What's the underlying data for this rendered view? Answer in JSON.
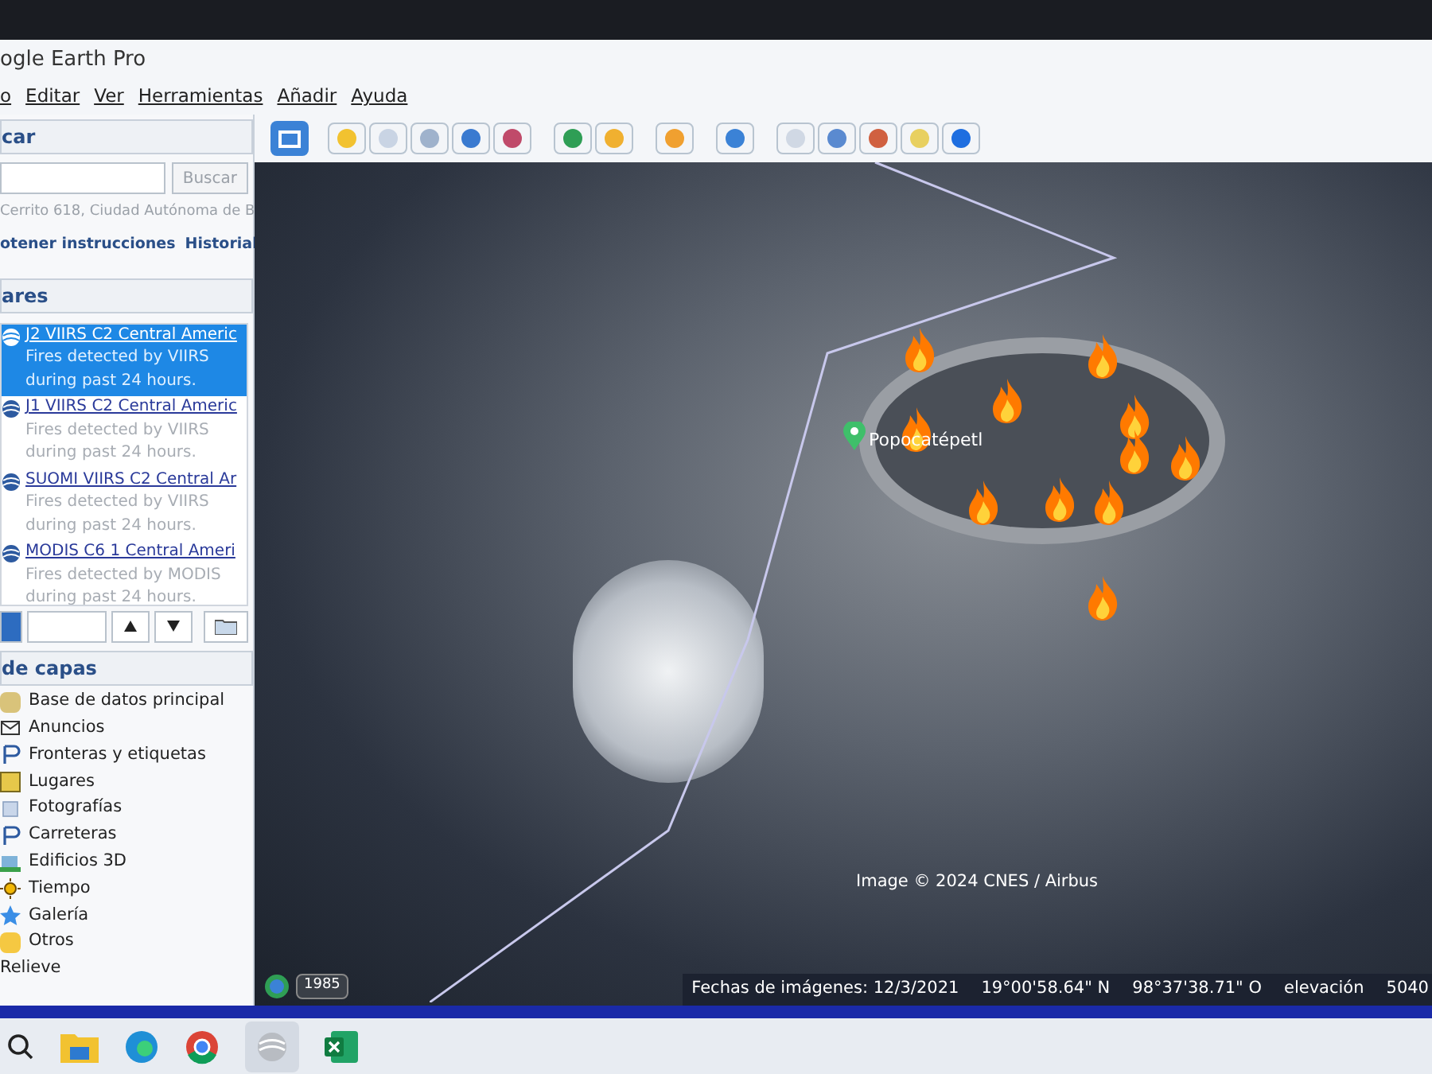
{
  "window": {
    "title": "ogle Earth Pro"
  },
  "menu": [
    "o",
    "Editar",
    "Ver",
    "Herramientas",
    "Añadir",
    "Ayuda"
  ],
  "search": {
    "header": "car",
    "button": "Buscar",
    "recent": "Cerrito 618, Ciudad Autónoma de B",
    "links": [
      "otener instrucciones",
      "Historial"
    ]
  },
  "places": {
    "header": "ares",
    "items": [
      {
        "title": "J2 VIIRS C2 Central Americ",
        "description": "Fires detected by VIIRS during past 24 hours.",
        "selected": true
      },
      {
        "title": "J1 VIIRS C2 Central Americ",
        "description": "Fires detected by VIIRS during past 24 hours.",
        "selected": false
      },
      {
        "title": "SUOMI VIIRS C2 Central Ar",
        "description": "Fires detected by VIIRS during past 24 hours.",
        "selected": false
      },
      {
        "title": "MODIS C6 1 Central Ameri",
        "description": "Fires detected by MODIS during past 24 hours.",
        "selected": false
      }
    ]
  },
  "layers": {
    "header": "de capas",
    "items": [
      {
        "label": "Base de datos principal",
        "kind": "database"
      },
      {
        "label": "Anuncios",
        "kind": "envelope"
      },
      {
        "label": "Fronteras y etiquetas",
        "kind": "flag"
      },
      {
        "label": "Lugares",
        "kind": "square"
      },
      {
        "label": "Fotografías",
        "kind": "photo"
      },
      {
        "label": "Carreteras",
        "kind": "flag"
      },
      {
        "label": "Edificios 3D",
        "kind": "building"
      },
      {
        "label": "Tiempo",
        "kind": "sun"
      },
      {
        "label": "Galería",
        "kind": "star"
      },
      {
        "label": "Otros",
        "kind": "note"
      },
      {
        "label": "Relieve",
        "kind": "none"
      }
    ]
  },
  "map": {
    "placemark": "Popocatépetl",
    "attribution": "Image © 2024 CNES / Airbus",
    "year": "1985",
    "status": [
      "Fechas de imágenes: 12/3/2021",
      "19°00'58.64\" N",
      "98°37'38.71\" O",
      "elevación",
      "5040"
    ]
  }
}
